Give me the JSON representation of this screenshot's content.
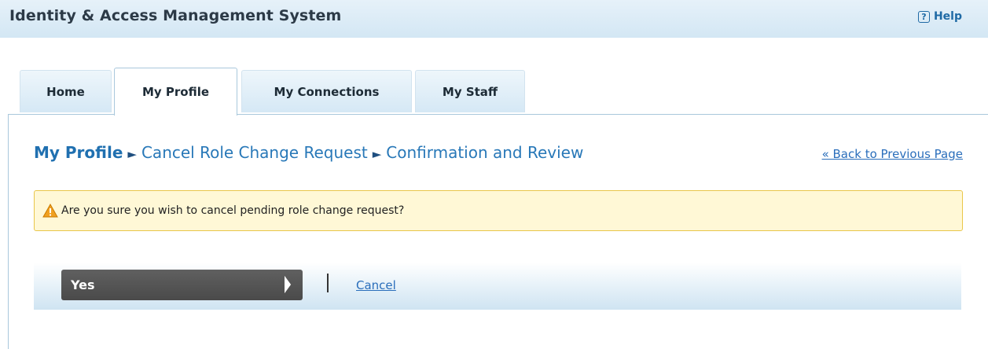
{
  "header": {
    "title": "Identity & Access Management System",
    "help_icon": "?",
    "help_label": "Help"
  },
  "tabs": [
    {
      "label": "Home",
      "active": false
    },
    {
      "label": "My Profile",
      "active": true
    },
    {
      "label": "My Connections",
      "active": false
    },
    {
      "label": "My Staff",
      "active": false
    }
  ],
  "breadcrumb": {
    "root": "My Profile",
    "separator": "►",
    "step1": "Cancel Role Change Request",
    "step2": "Confirmation and Review"
  },
  "back_link": "« Back to Previous Page",
  "alert": {
    "icon": "warning-triangle-icon",
    "text": "Are you sure you wish to cancel pending role change request?"
  },
  "actions": {
    "yes_label": "Yes",
    "cancel_label": "Cancel"
  },
  "colors": {
    "accent": "#2070b0",
    "alert_bg": "#fff8d6",
    "alert_border": "#e9c64a",
    "button_bg": "#555555"
  }
}
